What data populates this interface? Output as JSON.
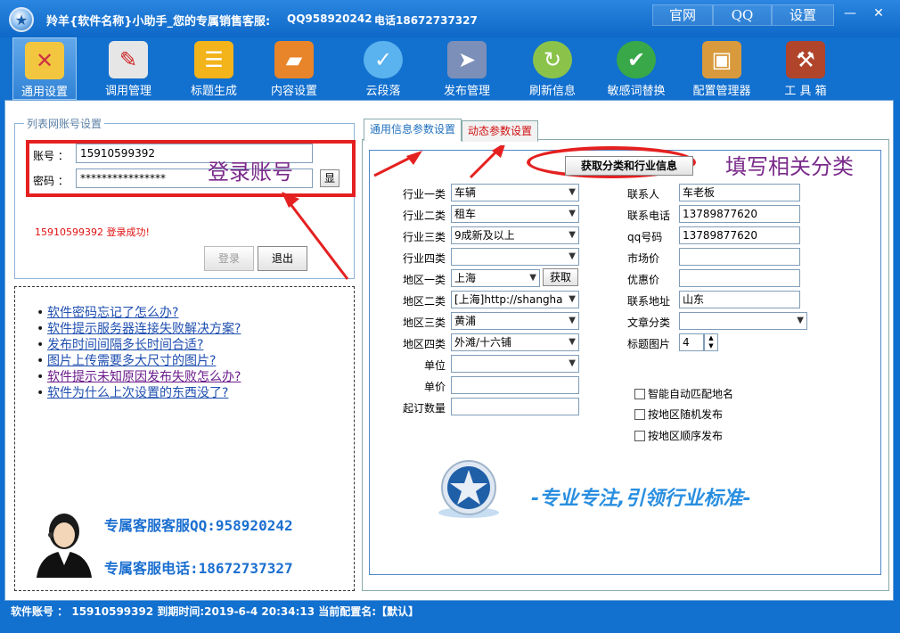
{
  "titlebar": {
    "title": "羚羊{软件名称}小助手_您的专属销售客服:",
    "qq": "QQ958920242",
    "phone": "电话18672737327",
    "links": [
      "官网",
      "QQ",
      "设置"
    ],
    "minimize": "—",
    "close": "✕"
  },
  "toolbar": {
    "items": [
      {
        "label": "通用设置",
        "icon": "tools-icon"
      },
      {
        "label": "调用管理",
        "icon": "notepad-icon"
      },
      {
        "label": "标题生成",
        "icon": "list-icon"
      },
      {
        "label": "内容设置",
        "icon": "folder-icon"
      },
      {
        "label": "云段落",
        "icon": "cloud-icon"
      },
      {
        "label": "发布管理",
        "icon": "publish-icon"
      },
      {
        "label": "刷新信息",
        "icon": "refresh-icon"
      },
      {
        "label": "敏感词替换",
        "icon": "check-shield-icon"
      },
      {
        "label": "配置管理器",
        "icon": "box-icon"
      },
      {
        "label": "工 具 箱",
        "icon": "toolbox-icon"
      }
    ]
  },
  "login": {
    "group_title": "列表网账号设置",
    "account_label": "账号 ：",
    "account_value": "15910599392",
    "password_label": "密码 ：",
    "password_value": "****************",
    "show_button": "显",
    "annotation": "登录账号",
    "status": "15910599392 登录成功!",
    "login_button": "登录",
    "logout_button": "退出"
  },
  "help": {
    "links": [
      "软件密码忘记了怎么办?",
      "软件提示服务器连接失败解决方案?",
      "发布时间间隔多长时间合适?",
      "图片上传需要多大尺寸的图片?",
      "软件提示未知原因发布失败怎么办?",
      "软件为什么上次设置的东西没了?"
    ],
    "cs_qq": "专属客服客服QQ:958920242",
    "cs_phone": "专属客服电话:18672737327"
  },
  "tabs": {
    "general": "通用信息参数设置",
    "dynamic": "动态参数设置"
  },
  "params": {
    "fetch_button": "获取分类和行业信息",
    "annotation": "填写相关分类",
    "left_fields": [
      {
        "label": "行业一类",
        "value": "车辆",
        "type": "select"
      },
      {
        "label": "行业二类",
        "value": "租车",
        "type": "select"
      },
      {
        "label": "行业三类",
        "value": "9成新及以上",
        "type": "select"
      },
      {
        "label": "行业四类",
        "value": "",
        "type": "select"
      },
      {
        "label": "地区一类",
        "value": "上海",
        "type": "select"
      },
      {
        "label": "地区二类",
        "value": "[上海]http://shangha",
        "type": "select"
      },
      {
        "label": "地区三类",
        "value": "黄浦",
        "type": "select"
      },
      {
        "label": "地区四类",
        "value": "外滩/十六铺",
        "type": "select"
      },
      {
        "label": "单位",
        "value": "",
        "type": "select"
      },
      {
        "label": "单价",
        "value": "",
        "type": "text"
      },
      {
        "label": "起订数量",
        "value": "",
        "type": "text"
      }
    ],
    "fetch_small": "获取",
    "right_fields": [
      {
        "label": "联系人",
        "value": "车老板"
      },
      {
        "label": "联系电话",
        "value": "13789877620"
      },
      {
        "label": "qq号码",
        "value": "13789877620"
      },
      {
        "label": "市场价",
        "value": ""
      },
      {
        "label": "优惠价",
        "value": ""
      },
      {
        "label": "联系地址",
        "value": "山东"
      },
      {
        "label": "文章分类",
        "value": ""
      },
      {
        "label": "标题图片",
        "value": "4"
      }
    ],
    "checkboxes": [
      "智能自动匹配地名",
      "按地区随机发布",
      "按地区顺序发布"
    ],
    "slogan": "-专业专注,引领行业标准-"
  },
  "status": {
    "text": "软件账号 ： 15910599392  到期时间:2019-6-4 20:34:13  当前配置名:【默认】"
  }
}
